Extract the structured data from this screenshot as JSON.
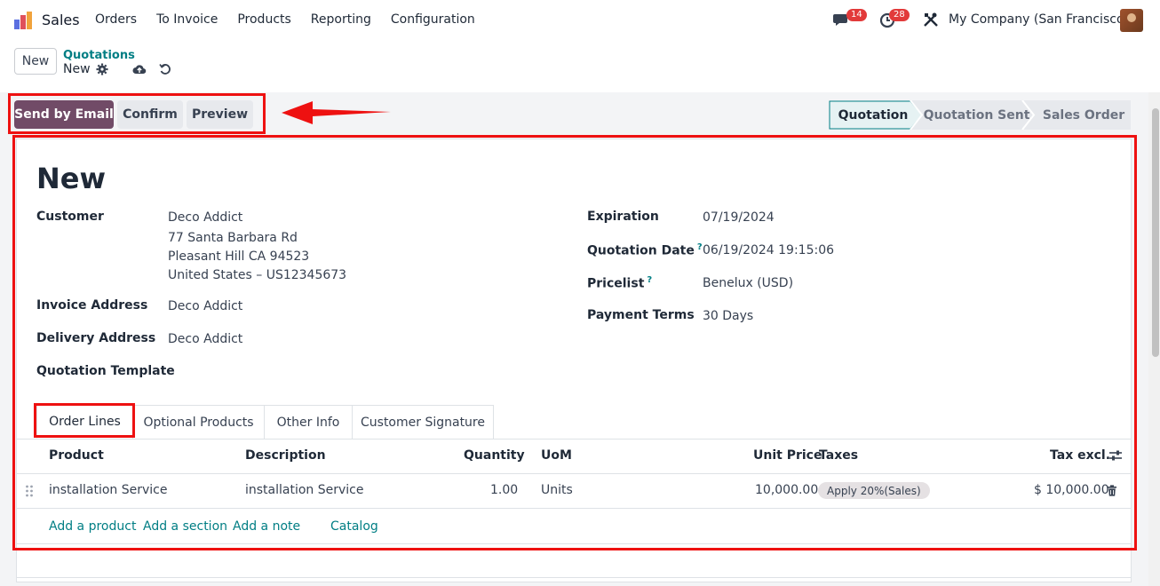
{
  "app": {
    "name": "Sales"
  },
  "menu": [
    "Orders",
    "To Invoice",
    "Products",
    "Reporting",
    "Configuration"
  ],
  "systray": {
    "messages_count": "14",
    "activities_count": "28",
    "company": "My Company (San Francisco)"
  },
  "control_panel": {
    "new_label": "New",
    "breadcrumb_parent": "Quotations",
    "breadcrumb_current": "New"
  },
  "actions": {
    "send_email": "Send by Email",
    "confirm": "Confirm",
    "preview": "Preview"
  },
  "stages": [
    {
      "label": "Quotation",
      "active": true
    },
    {
      "label": "Quotation Sent",
      "active": false
    },
    {
      "label": "Sales Order",
      "active": false
    }
  ],
  "form": {
    "title": "New",
    "customer_label": "Customer",
    "customer_lines": [
      "Deco Addict",
      "77 Santa Barbara Rd",
      "Pleasant Hill CA 94523",
      "United States – US12345673"
    ],
    "invoice_address_label": "Invoice Address",
    "invoice_address": "Deco Addict",
    "delivery_address_label": "Delivery Address",
    "delivery_address": "Deco Addict",
    "template_label": "Quotation Template",
    "expiration_label": "Expiration",
    "expiration": "07/19/2024",
    "quotation_date_label": "Quotation Date",
    "quotation_date": "06/19/2024 19:15:06",
    "pricelist_label": "Pricelist",
    "pricelist": "Benelux (USD)",
    "payment_terms_label": "Payment Terms",
    "payment_terms": "30 Days",
    "help_mark": "?"
  },
  "tabs": [
    "Order Lines",
    "Optional Products",
    "Other Info",
    "Customer Signature"
  ],
  "order_lines": {
    "columns": {
      "product": "Product",
      "description": "Description",
      "quantity": "Quantity",
      "uom": "UoM",
      "unit_price": "Unit Price",
      "taxes": "Taxes",
      "tax_excl": "Tax excl."
    },
    "rows": [
      {
        "product": "installation Service",
        "description": "installation Service",
        "quantity": "1.00",
        "uom": "Units",
        "unit_price": "10,000.00",
        "taxes": "Apply 20%(Sales)",
        "subtotal": "$ 10,000.00"
      }
    ],
    "add_links": {
      "product": "Add a product",
      "section": "Add a section",
      "note": "Add a note",
      "catalog": "Catalog"
    }
  },
  "colors": {
    "primary": "#714b67",
    "link": "#017e84",
    "annotation": "#ee1111",
    "badge": "#e23a3a"
  }
}
